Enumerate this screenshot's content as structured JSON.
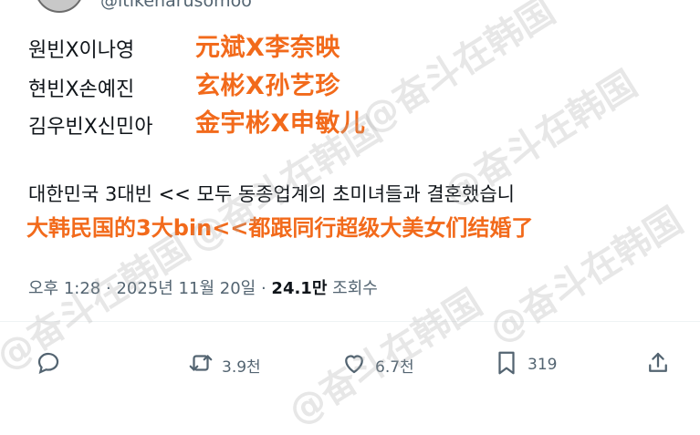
{
  "author": {
    "handle": "@itikeharusomoo"
  },
  "tweet": {
    "lines": [
      {
        "korean": "원빈X이나영",
        "chinese": "元斌X李奈映"
      },
      {
        "korean": "현빈X손예진",
        "chinese": "玄彬X孙艺珍"
      },
      {
        "korean": "김우빈X신민아",
        "chinese": "金宇彬X申敏儿"
      }
    ],
    "summary_korean": "대한민국 3대빈 << 모두 동종업계의 초미녀들과 결혼했습니",
    "summary_chinese": "大韩民国的3大bin<<都跟同行超级大美女们结婚了"
  },
  "meta": {
    "time": "오후 1:28",
    "date": "2025년 11월 20일",
    "separator": "·",
    "views_count": "24.1만",
    "views_label": "조회수"
  },
  "actions": {
    "retweets": "3.9천",
    "likes": "6.7천",
    "bookmarks": "319"
  },
  "watermark": "@奋斗在韩国",
  "colors": {
    "accent_translation": "#f26a1b",
    "secondary_text": "#536471"
  }
}
